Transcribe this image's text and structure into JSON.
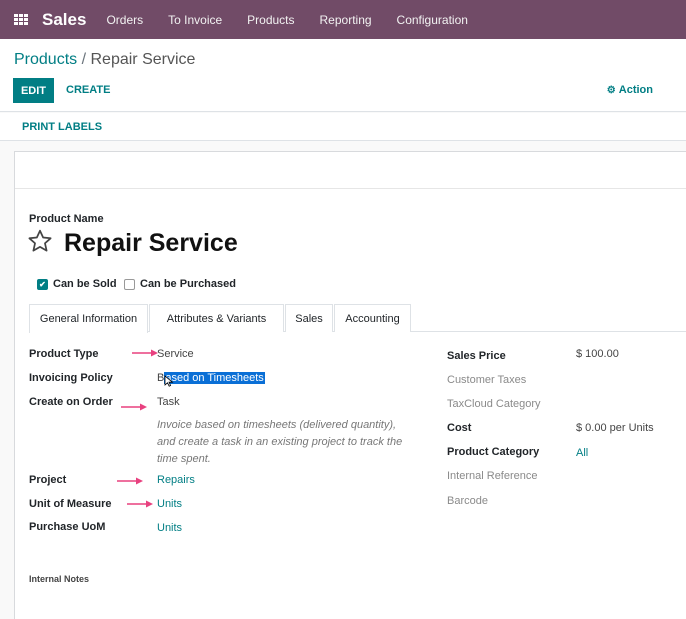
{
  "topbar": {
    "app_name": "Sales",
    "menu": [
      "Orders",
      "To Invoice",
      "Products",
      "Reporting",
      "Configuration"
    ]
  },
  "breadcrumb": {
    "parent": "Products",
    "separator": " / ",
    "current": "Repair Service"
  },
  "buttons": {
    "edit": "EDIT",
    "create": "CREATE",
    "action": "Action",
    "print_labels": "PRINT LABELS"
  },
  "product": {
    "name_label": "Product Name",
    "name": "Repair Service",
    "can_be_sold": "Can be Sold",
    "can_be_purchased": "Can be Purchased",
    "can_be_sold_checked": true,
    "can_be_purchased_checked": false
  },
  "tabs": [
    "General Information",
    "Attributes & Variants",
    "Sales",
    "Accounting"
  ],
  "left_fields": {
    "product_type_label": "Product Type",
    "product_type": "Service",
    "invoicing_policy_label": "Invoicing Policy",
    "invoicing_policy_pre": "B",
    "invoicing_policy_sel": "ased on Timesheets",
    "create_on_order_label": "Create on Order",
    "create_on_order": "Task",
    "help_text": "Invoice based on timesheets (delivered quantity), and create a task in an existing project to track the time spent.",
    "project_label": "Project",
    "project": "Repairs",
    "uom_label": "Unit of Measure",
    "uom": "Units",
    "purchase_uom_label": "Purchase UoM",
    "purchase_uom": "Units"
  },
  "right_fields": {
    "sales_price_label": "Sales Price",
    "sales_price": "$ 100.00",
    "customer_taxes_label": "Customer Taxes",
    "taxcloud_label": "TaxCloud Category",
    "cost_label": "Cost",
    "cost": "$ 0.00",
    "cost_unit": "per Units",
    "category_label": "Product Category",
    "category": "All",
    "internal_ref_label": "Internal Reference",
    "barcode_label": "Barcode"
  },
  "notes_label": "Internal Notes",
  "colors": {
    "topbar": "#714b67",
    "accent": "#017e84",
    "annotation_arrow": "#e8417f",
    "selection": "#0a6fd6"
  }
}
